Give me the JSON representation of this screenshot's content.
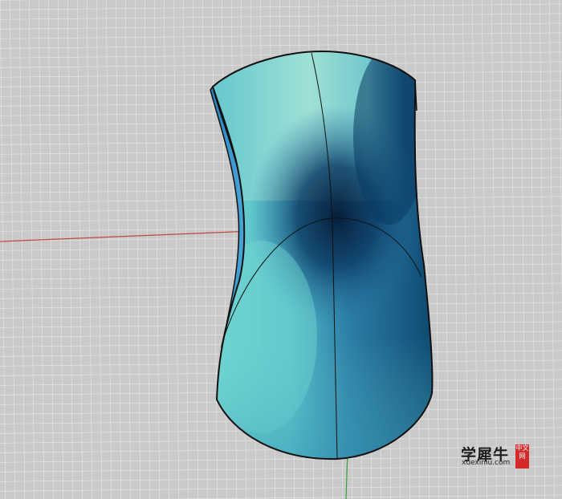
{
  "viewport": {
    "background_color": "#c9c9c9",
    "grid_color": "#ededed",
    "x_axis_color": "#c04545",
    "y_axis_color": "#3aa03a"
  },
  "model": {
    "surface_light": "#6ed2d0",
    "surface_mid": "#2c8fb0",
    "surface_dark": "#0a3a62",
    "edge_color": "#111111"
  },
  "watermark": {
    "title": "学犀牛",
    "domain": "xuexiniu.com",
    "seal": "中文网"
  }
}
